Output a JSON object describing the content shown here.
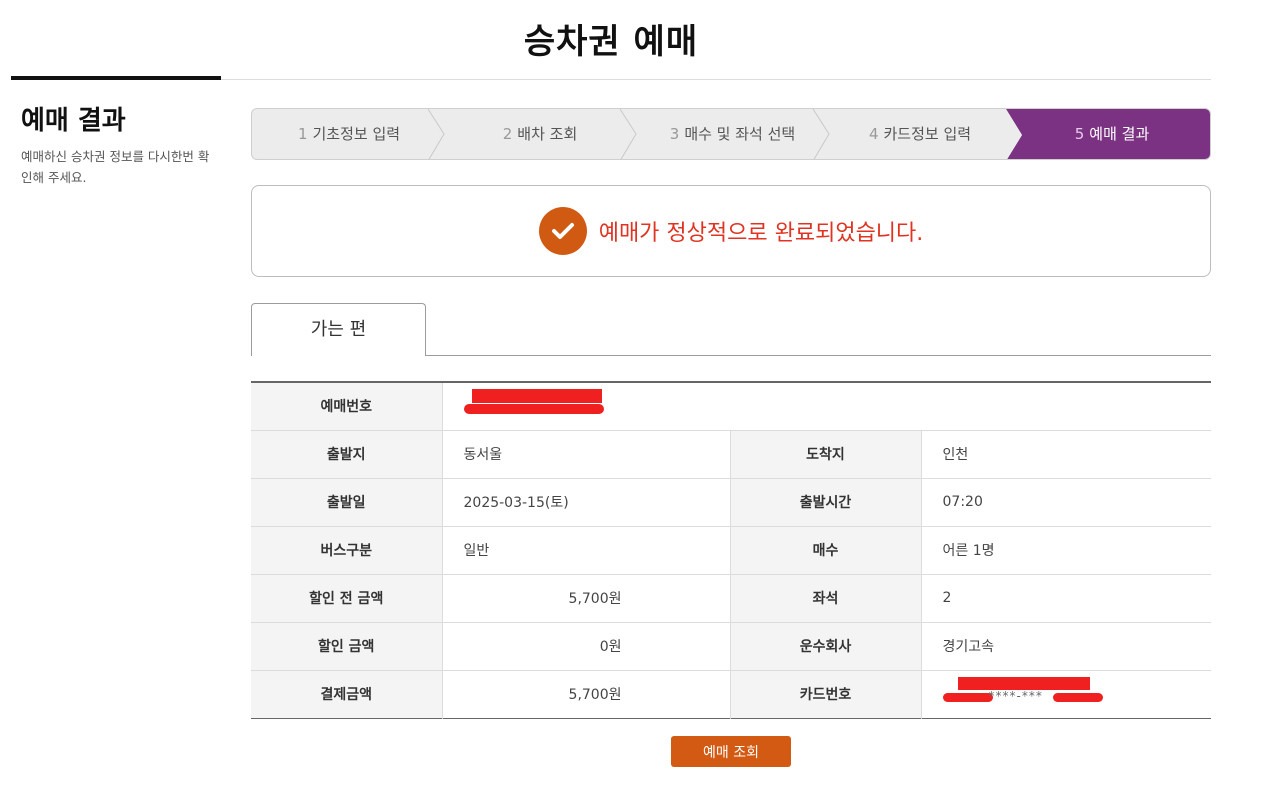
{
  "page": {
    "title": "승차권 예매"
  },
  "sidebar": {
    "title": "예매 결과",
    "desc": "예매하신 승차권 정보를 다시한번 확인해 주세요."
  },
  "steps": [
    {
      "num": "1",
      "label": "기초정보 입력",
      "active": false
    },
    {
      "num": "2",
      "label": "배차 조회",
      "active": false
    },
    {
      "num": "3",
      "label": "매수 및 좌석 선택",
      "active": false
    },
    {
      "num": "4",
      "label": "카드정보 입력",
      "active": false
    },
    {
      "num": "5",
      "label": "예매 결과",
      "active": true
    }
  ],
  "colors": {
    "active_step": "#7b3283",
    "accent": "#d35a13",
    "success_text": "#e03321"
  },
  "result": {
    "message": "예매가 정상적으로 완료되었습니다.",
    "icon": "check-circle-icon"
  },
  "tab": {
    "label": "가는 편"
  },
  "details": {
    "reservation_no": {
      "label": "예매번호",
      "value": ""
    },
    "departure": {
      "label": "출발지",
      "value": "동서울"
    },
    "arrival": {
      "label": "도착지",
      "value": "인천"
    },
    "date": {
      "label": "출발일",
      "value": "2025-03-15(토)"
    },
    "time": {
      "label": "출발시간",
      "value": "07:20"
    },
    "bus_type": {
      "label": "버스구분",
      "value": "일반"
    },
    "count": {
      "label": "매수",
      "value": "어른 1명"
    },
    "pre_discount": {
      "label": "할인 전 금액",
      "value": "5,700원"
    },
    "seat": {
      "label": "좌석",
      "value": "2"
    },
    "discount": {
      "label": "할인 금액",
      "value": "0원"
    },
    "company": {
      "label": "운수회사",
      "value": "경기고속"
    },
    "total": {
      "label": "결제금액",
      "value": "5,700원"
    },
    "card": {
      "label": "카드번호",
      "value": "****-***"
    }
  },
  "buttons": {
    "lookup": "예매 조회"
  }
}
